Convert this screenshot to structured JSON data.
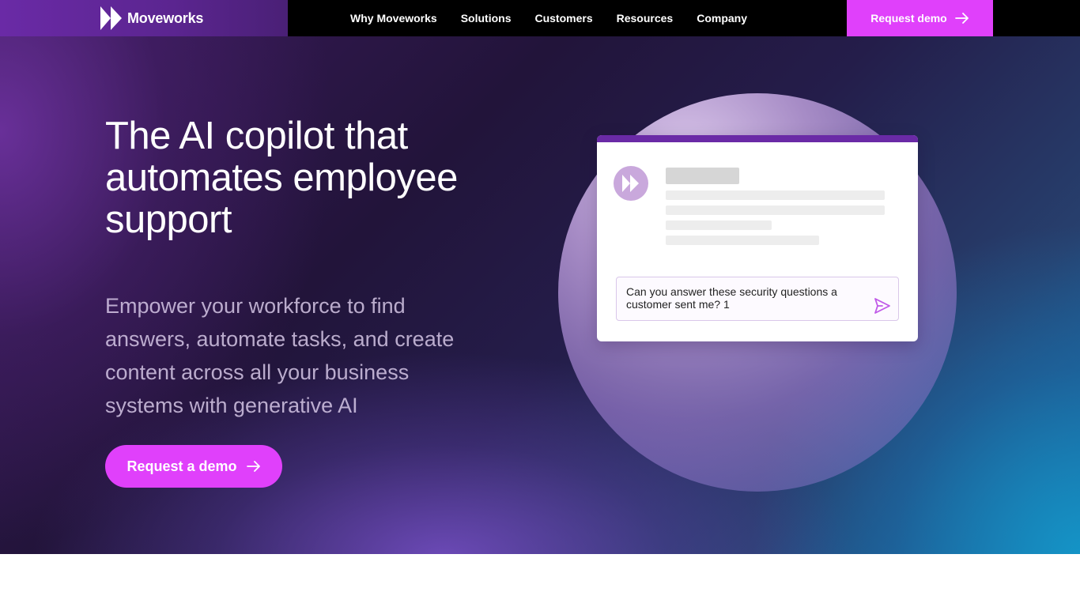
{
  "brand": {
    "name": "Moveworks",
    "logo_icon": "moveworks-logo-icon"
  },
  "nav": {
    "items": [
      {
        "label": "Why Moveworks"
      },
      {
        "label": "Solutions"
      },
      {
        "label": "Customers"
      },
      {
        "label": "Resources"
      },
      {
        "label": "Company"
      }
    ],
    "cta_label": "Request demo",
    "cta_icon": "arrow-right-icon"
  },
  "hero": {
    "headline": "The AI copilot that automates employee support",
    "subtext": "Empower your workforce to find answers, automate tasks, and create content across all your business systems with generative AI",
    "cta_label": "Request a demo",
    "cta_icon": "arrow-right-icon"
  },
  "chat_demo": {
    "avatar_icon": "moveworks-bot-avatar-icon",
    "input_text": "Can you answer these security questions a customer sent me? 1",
    "send_icon": "send-icon"
  },
  "colors": {
    "accent": "#e040fb",
    "brand_purple": "#6a2aa6",
    "nav_background": "#000000"
  }
}
